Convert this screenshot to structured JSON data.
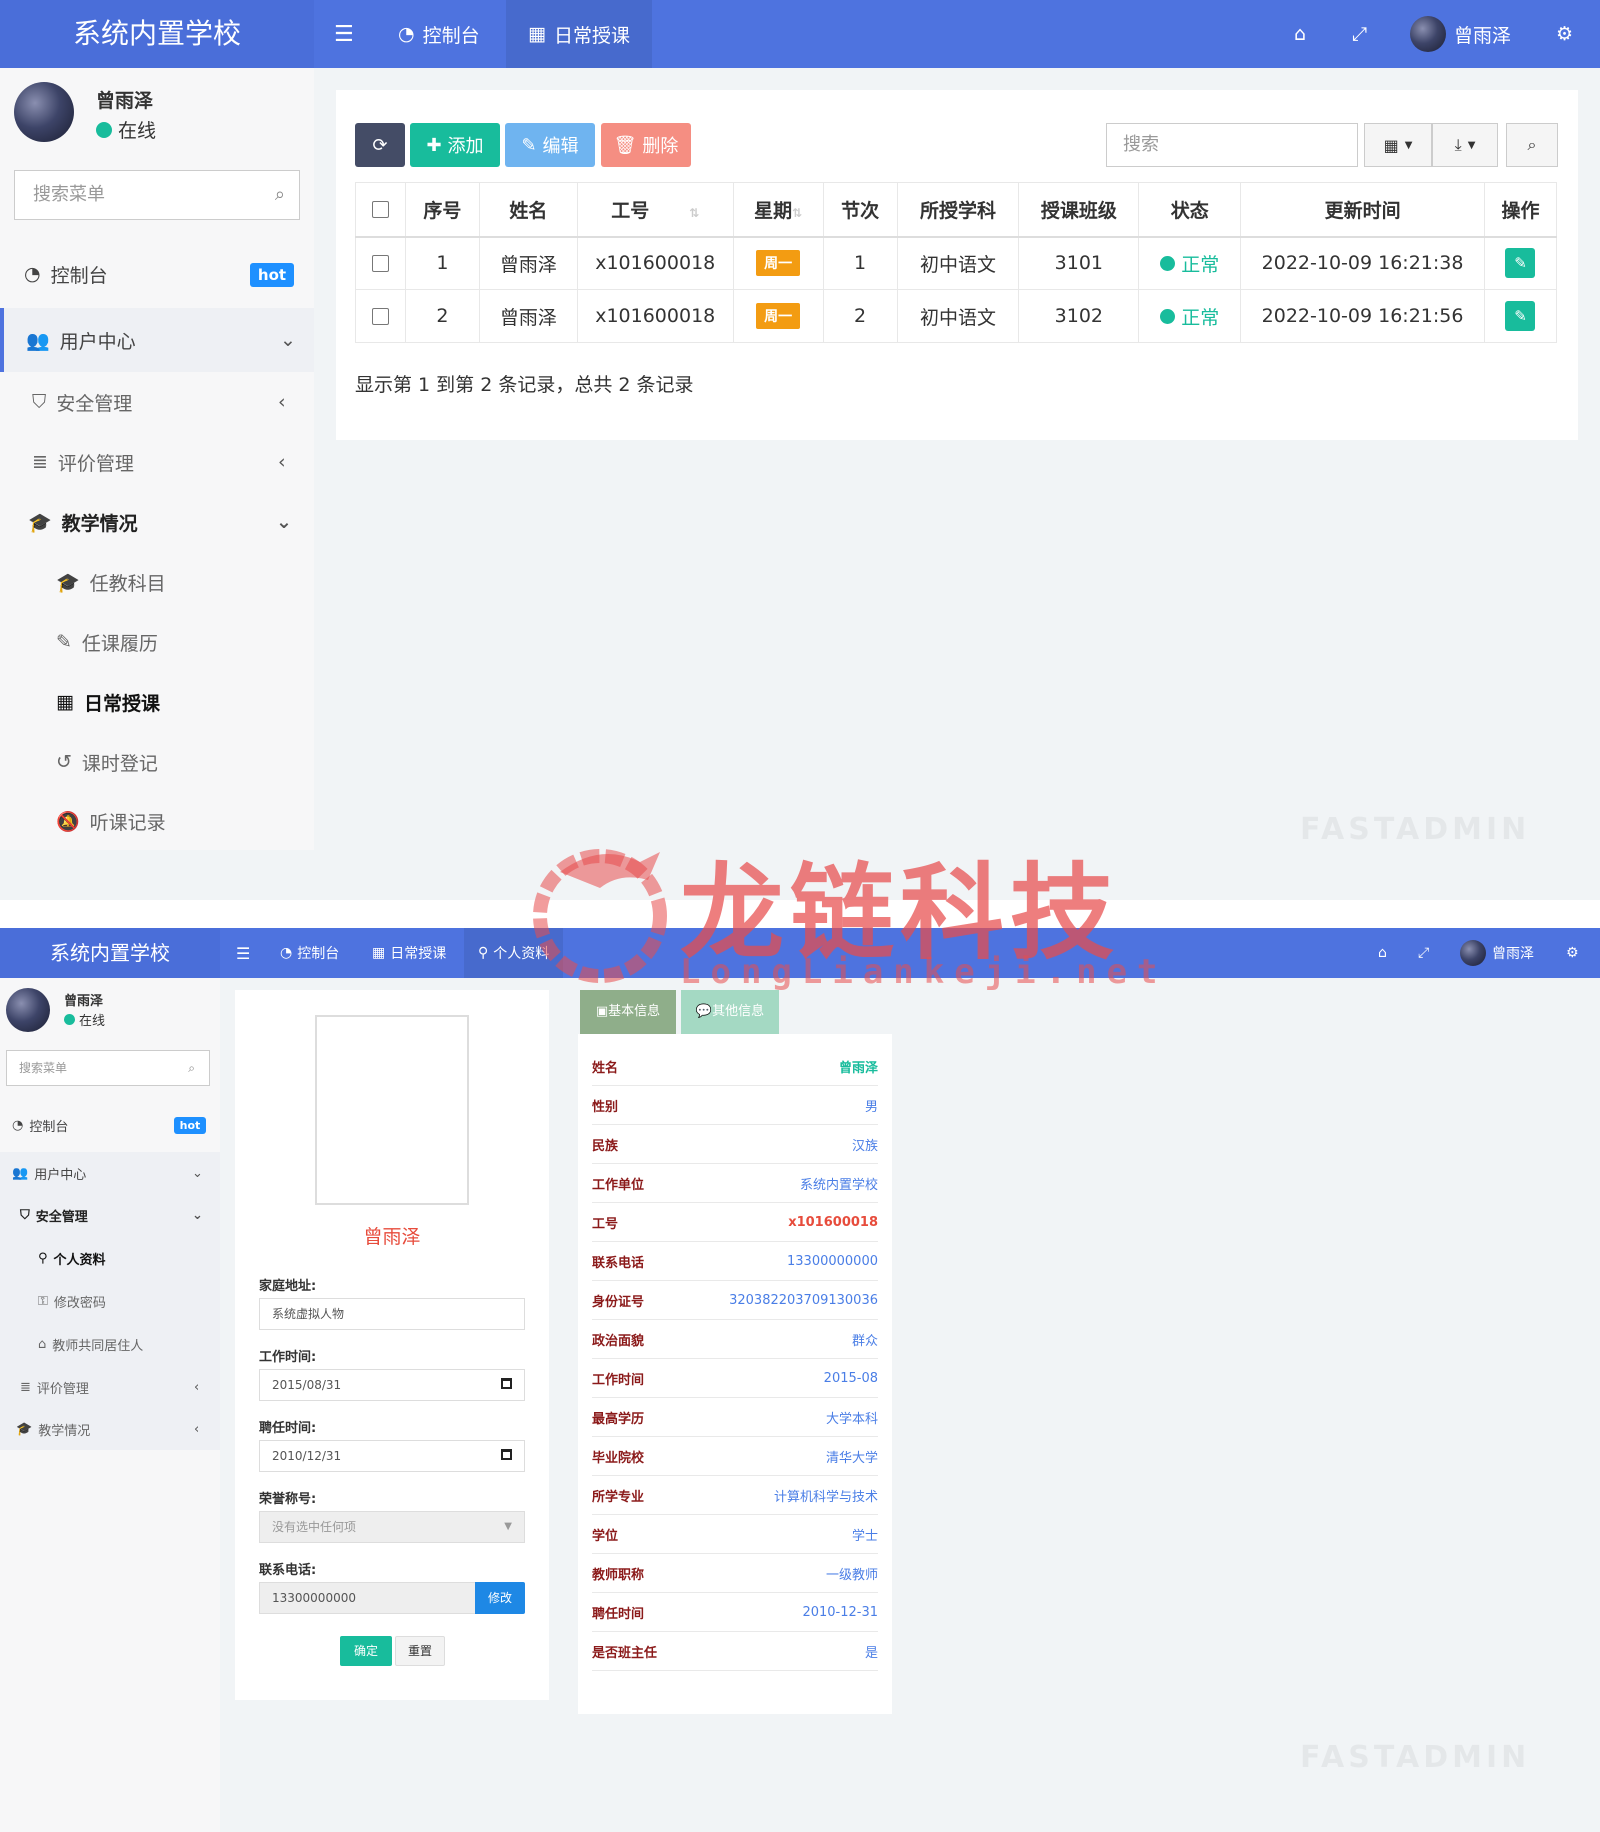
{
  "app": {
    "title": "系统内置学校",
    "user": "曾雨泽",
    "status": "在线",
    "menu_search_placeholder": "搜索菜单",
    "hot": "hot",
    "accent": "#4e73df"
  },
  "shot1": {
    "nav": {
      "dashboard": "控制台",
      "daily": "日常授课"
    },
    "menu": {
      "dashboard": "控制台",
      "user_center": "用户中心",
      "security": "安全管理",
      "evaluation": "评价管理",
      "teaching": "教学情况",
      "subjects": "任教科目",
      "history": "任课履历",
      "daily": "日常授课",
      "hours": "课时登记",
      "listen": "听课记录"
    },
    "toolbar": {
      "add": "添加",
      "edit": "编辑",
      "delete": "删除",
      "search_placeholder": "搜索"
    },
    "table": {
      "headers": [
        "序号",
        "姓名",
        "工号",
        "星期",
        "节次",
        "所授学科",
        "授课班级",
        "状态",
        "更新时间",
        "操作"
      ],
      "rows": [
        {
          "no": "1",
          "name": "曾雨泽",
          "id": "x101600018",
          "weekday": "周一",
          "period": "1",
          "subject": "初中语文",
          "class": "3101",
          "status": "正常",
          "updated": "2022-10-09 16:21:38"
        },
        {
          "no": "2",
          "name": "曾雨泽",
          "id": "x101600018",
          "weekday": "周一",
          "period": "2",
          "subject": "初中语文",
          "class": "3102",
          "status": "正常",
          "updated": "2022-10-09 16:21:56"
        }
      ]
    },
    "pagination": "显示第 1 到第 2 条记录，总共 2 条记录"
  },
  "shot2": {
    "nav": {
      "dashboard": "控制台",
      "daily": "日常授课",
      "profile": "个人资料"
    },
    "menu": {
      "dashboard": "控制台",
      "user_center": "用户中心",
      "security": "安全管理",
      "profile": "个人资料",
      "password": "修改密码",
      "cohabitant": "教师共同居住人",
      "evaluation": "评价管理",
      "teaching": "教学情况"
    },
    "form": {
      "name": "曾雨泽",
      "address_label": "家庭地址:",
      "address": "系统虚拟人物",
      "work_time_label": "工作时间:",
      "work_time": "2015/08/31",
      "hire_time_label": "聘任时间:",
      "hire_time": "2010/12/31",
      "honor_label": "荣誉称号:",
      "honor": "没有选中任何项",
      "phone_label": "联系电话:",
      "phone": "13300000000",
      "modify": "修改",
      "confirm": "确定",
      "reset": "重置"
    },
    "tabs": {
      "basic": "基本信息",
      "other": "其他信息"
    },
    "info": [
      {
        "k": "姓名",
        "v": "曾雨泽"
      },
      {
        "k": "性别",
        "v": "男"
      },
      {
        "k": "民族",
        "v": "汉族"
      },
      {
        "k": "工作单位",
        "v": "系统内置学校"
      },
      {
        "k": "工号",
        "v": "x101600018"
      },
      {
        "k": "联系电话",
        "v": "13300000000"
      },
      {
        "k": "身份证号",
        "v": "320382203709130036"
      },
      {
        "k": "政治面貌",
        "v": "群众"
      },
      {
        "k": "工作时间",
        "v": "2015-08"
      },
      {
        "k": "最高学历",
        "v": "大学本科"
      },
      {
        "k": "毕业院校",
        "v": "清华大学"
      },
      {
        "k": "所学专业",
        "v": "计算机科学与技术"
      },
      {
        "k": "学位",
        "v": "学士"
      },
      {
        "k": "教师职称",
        "v": "一级教师"
      },
      {
        "k": "聘任时间",
        "v": "2010-12-31"
      },
      {
        "k": "是否班主任",
        "v": "是"
      }
    ]
  },
  "watermark": {
    "title": "龙链科技",
    "sub": "LongLiankeji.net",
    "faint": "FASTADMIN"
  }
}
